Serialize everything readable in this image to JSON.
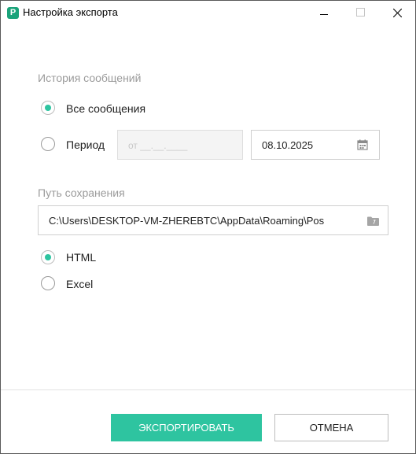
{
  "window": {
    "title": "Настройка экспорта",
    "app_icon": "posrednik-logo",
    "controls": [
      "minimize-icon",
      "maximize-icon",
      "close-icon"
    ]
  },
  "history": {
    "label": "История сообщений",
    "option_all": {
      "label": "Все сообщения",
      "checked": true
    },
    "option_period": {
      "label": "Период",
      "checked": false,
      "from_placeholder": "от __.__.____",
      "to_value": "08.10.2025",
      "calendar_icon": "calendar-icon"
    }
  },
  "save_path": {
    "label": "Путь сохранения",
    "value": "C:\\Users\\DESKTOP-VM-ZHEREBTC\\AppData\\Roaming\\Pos",
    "folder_icon": "folder-icon"
  },
  "format": {
    "html": {
      "label": "HTML",
      "checked": true
    },
    "excel": {
      "label": "Excel",
      "checked": false
    }
  },
  "buttons": {
    "export": "ЭКСПОРТИРОВАТЬ",
    "cancel": "ОТМЕНА"
  },
  "colors": {
    "accent": "#2ec4a0",
    "app_icon": "#1aa37a"
  }
}
